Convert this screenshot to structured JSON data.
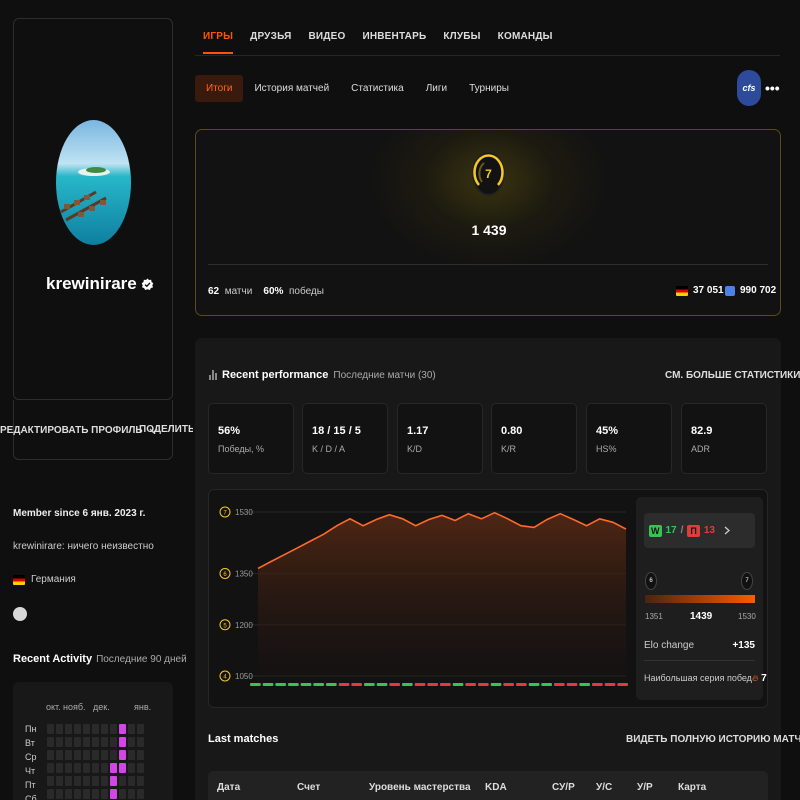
{
  "colors": {
    "accent": "#ff5500",
    "win": "#36c453",
    "loss": "#e23b3b",
    "level": "#f7c825",
    "activity": "#d346e6"
  },
  "profile": {
    "username": "krewinirare",
    "verified_icon": "verified-badge-icon",
    "edit_label": "РЕДАКТИРОВАТЬ ПРОФИЛЬ",
    "share_label": "ПОДЕЛИТЬСЯ",
    "member_since": "Member since 6 янв. 2023 г.",
    "bio": "krewinirare: ничего неизвестно",
    "country": "Германия"
  },
  "activity": {
    "title": "Recent Activity",
    "subtitle": "Последние 90 дней",
    "months": [
      "окт.",
      "нояб.",
      "дек.",
      "янв."
    ],
    "days": [
      "Пн",
      "Вт",
      "Ср",
      "Чт",
      "Пт",
      "Сб"
    ],
    "grid": [
      [
        0,
        0,
        0,
        0,
        0,
        0,
        0,
        0,
        1,
        0,
        0,
        0
      ],
      [
        0,
        0,
        0,
        0,
        0,
        0,
        0,
        0,
        1,
        0,
        0,
        0
      ],
      [
        0,
        0,
        0,
        0,
        0,
        0,
        0,
        0,
        1,
        0,
        0,
        0
      ],
      [
        0,
        0,
        0,
        0,
        0,
        0,
        0,
        1,
        1,
        0,
        0,
        0
      ],
      [
        0,
        0,
        0,
        0,
        0,
        0,
        0,
        1,
        0,
        0,
        0,
        0
      ],
      [
        0,
        0,
        0,
        0,
        0,
        0,
        0,
        1,
        0,
        0,
        0,
        0
      ]
    ]
  },
  "nav": {
    "tabs": [
      "ИГРЫ",
      "ДРУЗЬЯ",
      "ВИДЕО",
      "ИНВЕНТАРЬ",
      "КЛУБЫ",
      "КОМАНДЫ"
    ],
    "active": 0,
    "subtabs": [
      "Итоги",
      "История матчей",
      "Статистика",
      "Лиги",
      "Турниры"
    ],
    "sub_active": 0,
    "game_logo": "cfs",
    "more": "•••"
  },
  "elo": {
    "level": "7",
    "value": "1 439",
    "matches": "62",
    "matches_label": "матчи",
    "winrate": "60%",
    "winrate_label": "победы",
    "region_rank": "37 051",
    "global_rank": "990 702"
  },
  "performance": {
    "title": "Recent performance",
    "subtitle": "Последние матчи (30)",
    "see_more": "СМ. БОЛЬШЕ СТАТИСТИКИ",
    "cards": [
      {
        "value": "56%",
        "label": "Победы, %"
      },
      {
        "value": "18 / 15 / 5",
        "label": "K / D / A"
      },
      {
        "value": "1.17",
        "label": "K/D"
      },
      {
        "value": "0.80",
        "label": "K/R"
      },
      {
        "value": "45%",
        "label": "HS%"
      },
      {
        "value": "82.9",
        "label": "ADR"
      }
    ]
  },
  "chart_data": {
    "type": "area",
    "ylim": [
      1050,
      1530
    ],
    "y_ticks": [
      {
        "label": "1530",
        "level": "7"
      },
      {
        "label": "1350",
        "level": "6"
      },
      {
        "label": "1200",
        "level": "5"
      },
      {
        "label": "1050",
        "level": "4"
      }
    ],
    "values": [
      1365,
      1385,
      1405,
      1425,
      1445,
      1465,
      1490,
      1510,
      1490,
      1508,
      1522,
      1510,
      1490,
      1508,
      1520,
      1505,
      1525,
      1510,
      1528,
      1510,
      1490,
      1485,
      1508,
      1525,
      1508,
      1490,
      1510,
      1500,
      1480
    ],
    "results": [
      "W",
      "W",
      "W",
      "W",
      "W",
      "W",
      "W",
      "L",
      "L",
      "W",
      "W",
      "L",
      "W",
      "L",
      "L",
      "L",
      "W",
      "L",
      "L",
      "W",
      "L",
      "L",
      "W",
      "W",
      "L",
      "L",
      "W",
      "L",
      "L",
      "L"
    ]
  },
  "summary": {
    "wins": "17",
    "losses": "13",
    "w_tag": "W",
    "l_tag": "П",
    "range_min": "1351",
    "range_cur": "1439",
    "range_max": "1530",
    "level_from": "6",
    "level_to": "7",
    "elo_change_label": "Elo change",
    "elo_change": "+135",
    "streak_label": "Наибольшая серия побед",
    "streak": "7"
  },
  "matches": {
    "title": "Last matches",
    "full_history": "ВИДЕТЬ ПОЛНУЮ ИСТОРИЮ МАТЧЕЙ",
    "columns": [
      "Дата",
      "Счет",
      "Уровень мастерства",
      "KDA",
      "СУ/Р",
      "У/С",
      "У/Р",
      "Карта"
    ]
  }
}
